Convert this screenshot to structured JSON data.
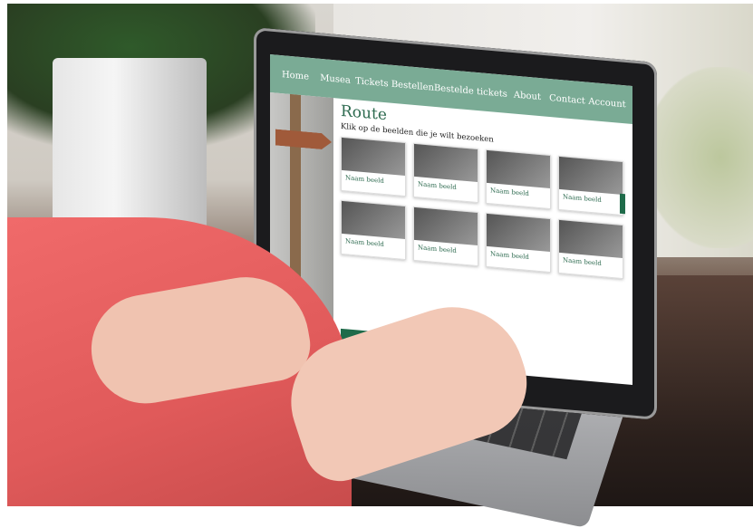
{
  "scene": "laptop-with-website",
  "website": {
    "nav": [
      "Home",
      "Musea",
      "Tickets Bestellen",
      "Bestelde tickets",
      "About",
      "Contact",
      "Account"
    ],
    "page_title": "Route",
    "instruction": "Klik op de beelden die je wilt bezoeken",
    "cards": [
      {
        "label": "Naam beeld"
      },
      {
        "label": "Naam beeld"
      },
      {
        "label": "Naam beeld"
      },
      {
        "label": "Naam beeld"
      },
      {
        "label": "Naam beeld"
      },
      {
        "label": "Naam beeld"
      },
      {
        "label": "Naam beeld"
      },
      {
        "label": "Naam beeld"
      }
    ],
    "accent_color": "#7aab95",
    "button_color": "#1f6b4a"
  }
}
